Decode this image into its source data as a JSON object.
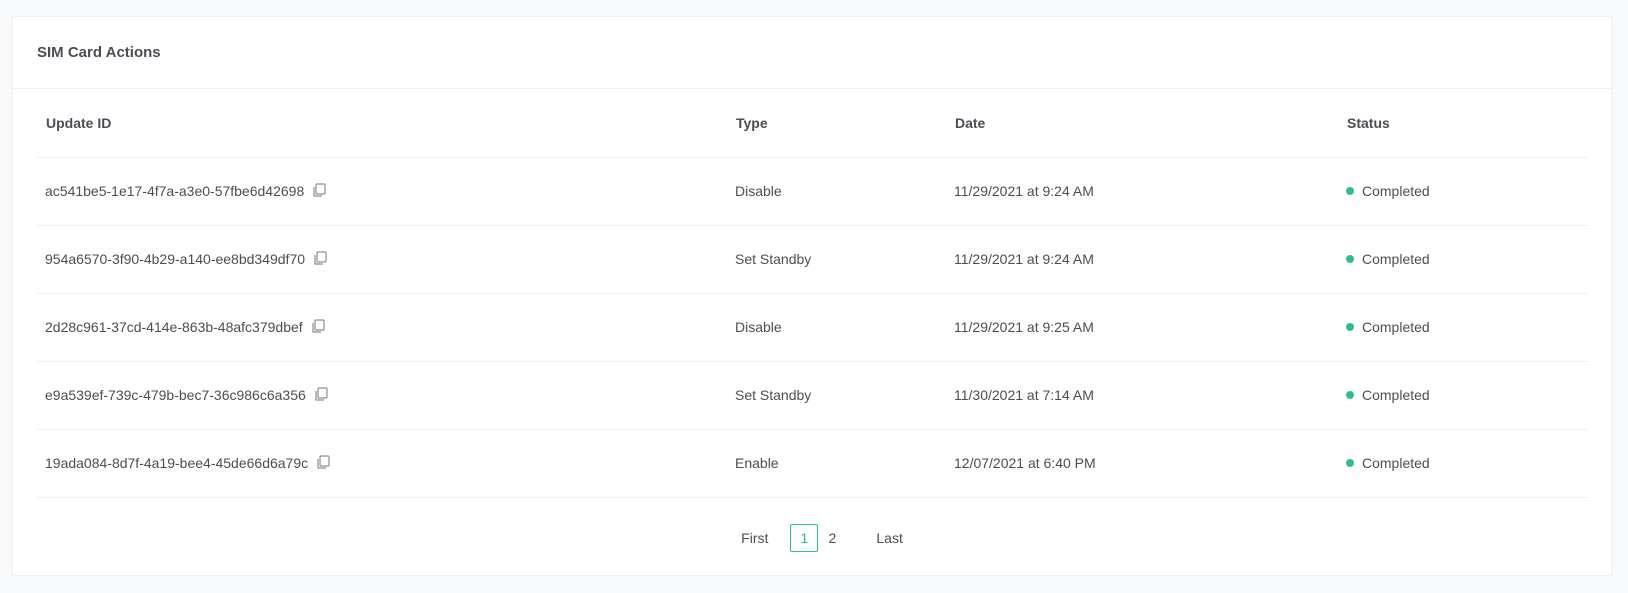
{
  "card": {
    "title": "SIM Card Actions"
  },
  "table": {
    "columns": [
      "Update ID",
      "Type",
      "Date",
      "Status"
    ],
    "rows": [
      {
        "id": "ac541be5-1e17-4f7a-a3e0-57fbe6d42698",
        "type": "Disable",
        "date": "11/29/2021 at 9:24 AM",
        "status": "Completed"
      },
      {
        "id": "954a6570-3f90-4b29-a140-ee8bd349df70",
        "type": "Set Standby",
        "date": "11/29/2021 at 9:24 AM",
        "status": "Completed"
      },
      {
        "id": "2d28c961-37cd-414e-863b-48afc379dbef",
        "type": "Disable",
        "date": "11/29/2021 at 9:25 AM",
        "status": "Completed"
      },
      {
        "id": "e9a539ef-739c-479b-bec7-36c986c6a356",
        "type": "Set Standby",
        "date": "11/30/2021 at 7:14 AM",
        "status": "Completed"
      },
      {
        "id": "19ada084-8d7f-4a19-bee4-45de66d6a79c",
        "type": "Enable",
        "date": "12/07/2021 at 6:40 PM",
        "status": "Completed"
      }
    ],
    "copy_icon": "copy-icon",
    "status_color": "#2ebf8b"
  },
  "pagination": {
    "first_label": "First",
    "pages": [
      "1",
      "2"
    ],
    "current_page": "1",
    "last_label": "Last"
  }
}
